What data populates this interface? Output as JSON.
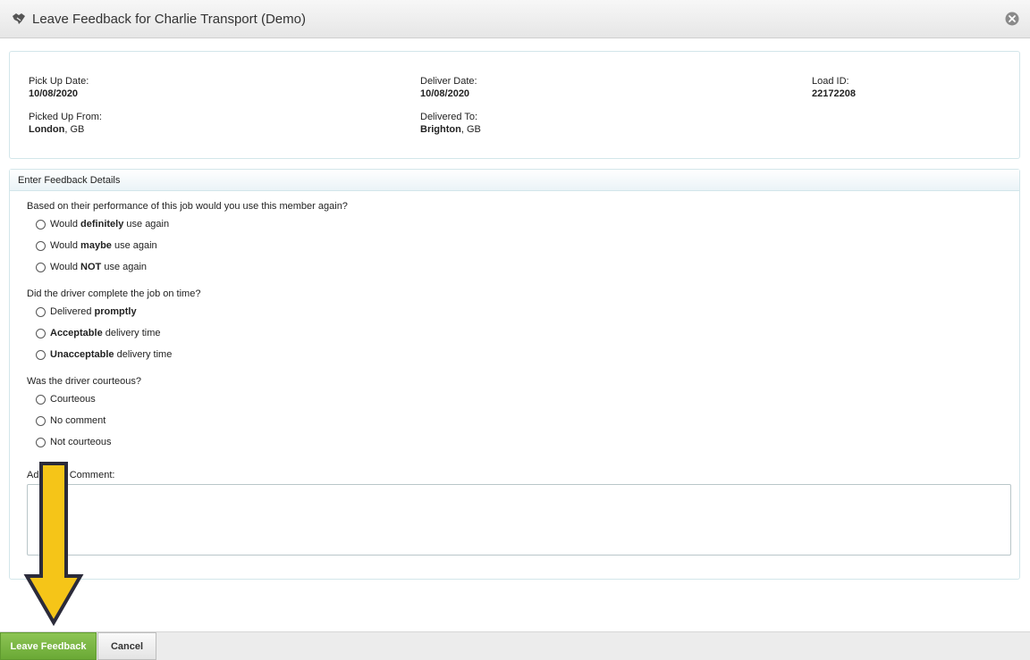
{
  "dialog": {
    "title": "Leave Feedback for Charlie Transport (Demo)",
    "title_icon": "handshake-icon",
    "close_icon": "close-icon"
  },
  "load_info": {
    "pickup_date_label": "Pick Up Date:",
    "pickup_date": "10/08/2020",
    "deliver_date_label": "Deliver Date:",
    "deliver_date": "10/08/2020",
    "load_id_label": "Load ID:",
    "load_id": "22172208",
    "picked_up_from_label": "Picked Up From:",
    "picked_up_from_city": "London",
    "picked_up_from_country": ", GB",
    "delivered_to_label": "Delivered To:",
    "delivered_to_city": "Brighton",
    "delivered_to_country": ", GB"
  },
  "form": {
    "header": "Enter Feedback Details",
    "questions": [
      {
        "text": "Based on their performance of this job would you use this member again?",
        "options": [
          {
            "pre": "Would ",
            "bold": "definitely",
            "post": " use again"
          },
          {
            "pre": "Would ",
            "bold": "maybe",
            "post": " use again"
          },
          {
            "pre": "Would ",
            "bold": "NOT",
            "post": " use again"
          }
        ]
      },
      {
        "text": "Did the driver complete the job on time?",
        "options": [
          {
            "pre": "Delivered ",
            "bold": "promptly",
            "post": ""
          },
          {
            "pre": "",
            "bold": "Acceptable",
            "post": " delivery time"
          },
          {
            "pre": "",
            "bold": "Unacceptable",
            "post": " delivery time"
          }
        ]
      },
      {
        "text": "Was the driver courteous?",
        "options": [
          {
            "pre": "Courteous",
            "bold": "",
            "post": ""
          },
          {
            "pre": "No comment",
            "bold": "",
            "post": ""
          },
          {
            "pre": "Not courteous",
            "bold": "",
            "post": ""
          }
        ]
      }
    ],
    "comment_label": "Add Your Comment:",
    "comment_value": ""
  },
  "buttons": {
    "submit_label": "Leave Feedback",
    "cancel_label": "Cancel"
  },
  "colors": {
    "submit_green": "#6aa935",
    "arrow_yellow": "#f5c518",
    "panel_border": "#d3e6ea"
  }
}
